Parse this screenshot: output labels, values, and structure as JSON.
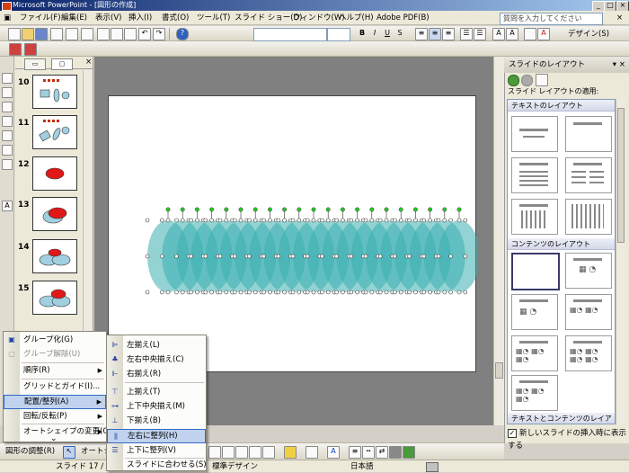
{
  "title_bar": {
    "title": "Microsoft PowerPoint - [図形の作成]",
    "buttons": [
      "_",
      "□",
      "×"
    ]
  },
  "menu_bar": {
    "items": [
      "ファイル(F)",
      "編集(E)",
      "表示(V)",
      "挿入(I)",
      "書式(O)",
      "ツール(T)",
      "スライド ショー(D)",
      "ウィンドウ(W)",
      "ヘルプ(H)",
      "Adobe PDF(B)"
    ],
    "help_placeholder": "質問を入力してください",
    "close_button": "×"
  },
  "toolbar": {
    "design_label": "デザイン(S)",
    "bold": "B",
    "italic": "I",
    "underline": "U",
    "shadow": "S"
  },
  "slide_panel": {
    "tabs": [
      "▭",
      "▢"
    ],
    "thumbnails": [
      {
        "number": "10"
      },
      {
        "number": "11"
      },
      {
        "number": "12"
      },
      {
        "number": "13"
      },
      {
        "number": "14"
      },
      {
        "number": "15"
      }
    ]
  },
  "task_pane": {
    "title": "スライドのレイアウト",
    "apply_label": "スライド レイアウトの適用:",
    "sections": [
      "テキストのレイアウト",
      "コンテンツのレイアウト",
      "テキストとコンテンツのレイアウト"
    ],
    "show_on_insert_label": "新しいスライドの挿入時に表示する",
    "show_on_insert_checked": "✓",
    "accent_color": "#316ac5"
  },
  "draw_menu": {
    "items": [
      {
        "label": "グループ化(G)",
        "disabled": false
      },
      {
        "label": "グループ解除(U)",
        "disabled": true
      },
      {
        "label": "順序(R)",
        "submenu": true
      },
      {
        "label": "グリッドとガイド(I)..."
      },
      {
        "label": "配置/整列(A)",
        "submenu": true,
        "highlighted": true
      },
      {
        "label": "回転/反転(P)",
        "submenu": true
      },
      {
        "label": "オートシェイプの変更(C)",
        "submenu": true
      }
    ],
    "more": "⌄"
  },
  "align_menu": {
    "items": [
      {
        "label": "左揃え(L)",
        "icon": "align-left-icon"
      },
      {
        "label": "左右中央揃え(C)",
        "icon": "align-center-icon"
      },
      {
        "label": "右揃え(R)",
        "icon": "align-right-icon"
      },
      {
        "label": "上揃え(T)",
        "icon": "align-top-icon"
      },
      {
        "label": "上下中央揃え(M)",
        "icon": "align-middle-icon"
      },
      {
        "label": "下揃え(B)",
        "icon": "align-bottom-icon"
      },
      {
        "label": "左右に整列(H)",
        "icon": "distribute-horizontal-icon",
        "highlighted": true
      },
      {
        "label": "上下に整列(V)",
        "icon": "distribute-vertical-icon"
      },
      {
        "label": "スライドに合わせる(S)"
      }
    ]
  },
  "draw_toolbar": {
    "draw_label": "図形の調整(R)",
    "autoshape_label": "オートシ"
  },
  "status_bar": {
    "slide": "スライド 17 / 17",
    "design": "標準デザイン",
    "language": "日本語"
  },
  "shape_color": "#3aaeb0"
}
